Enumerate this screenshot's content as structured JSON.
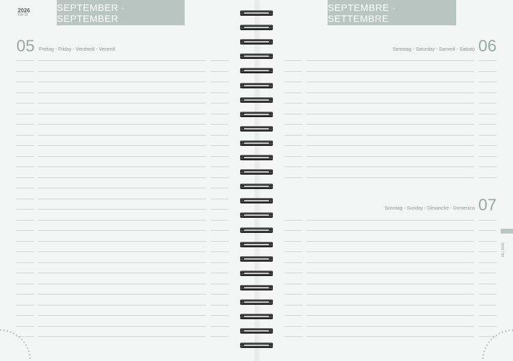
{
  "left_page": {
    "year": "2026",
    "week": "KW 36",
    "month_title": "SEPTEMBER · SEPTEMBER",
    "day": {
      "number": "05",
      "names": "Freitag - Friday - Vendredi - Venerdì"
    }
  },
  "right_page": {
    "month_title": "SEPTEMBRE · SETTEMBRE",
    "days": [
      {
        "number": "06",
        "names": "Samstag - Saturday - Samedi - Sabato"
      },
      {
        "number": "07",
        "names": "Sonntag - Sunday - Dimanche - Domenica"
      }
    ],
    "side_tab": "09 | 2026"
  },
  "colors": {
    "banner": "#b8c5c0",
    "day_number": "#98a8a2",
    "line": "#cfd6d3",
    "page": "#f4f6f5"
  }
}
